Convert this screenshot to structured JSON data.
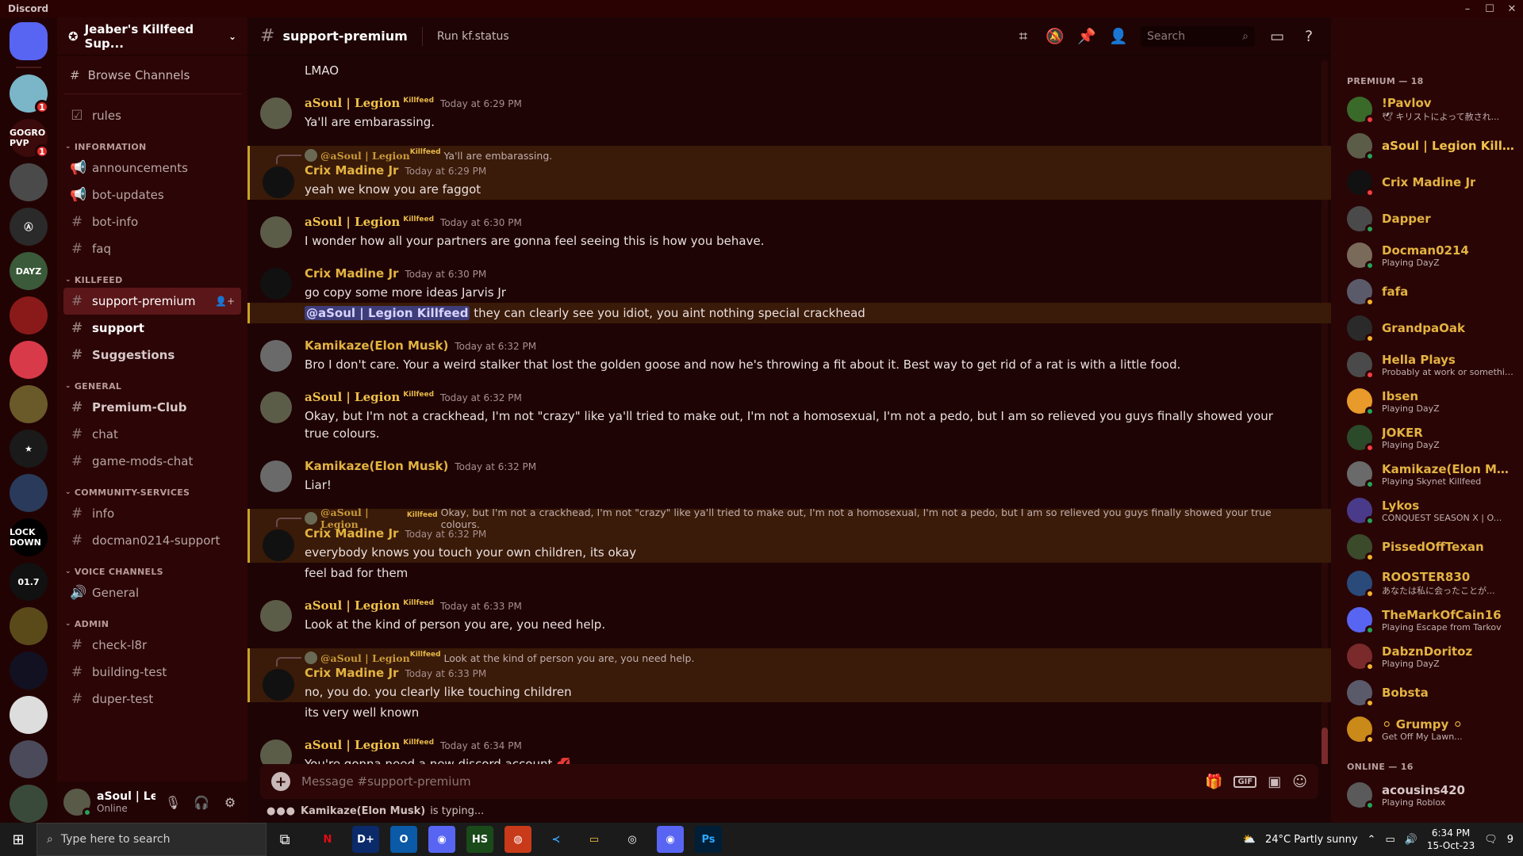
{
  "window": {
    "title": "Discord",
    "controls": [
      "–",
      "☐",
      "✕"
    ]
  },
  "rail": {
    "servers": [
      {
        "label": "",
        "color": "#5865f2",
        "badge": ""
      },
      {
        "label": "",
        "color": "#7ab6c8",
        "badge": "1"
      },
      {
        "label": "GOGRO PVP",
        "color": "#3b0a0a",
        "badge": "1"
      },
      {
        "label": "",
        "color": "#4a4a4a",
        "badge": ""
      },
      {
        "label": "Ⓐ",
        "color": "#2a2a2a",
        "badge": ""
      },
      {
        "label": "DAYZ",
        "color": "#3a5a3a",
        "badge": ""
      },
      {
        "label": "",
        "color": "#8a1a1a",
        "badge": ""
      },
      {
        "label": "",
        "color": "#d83a4a",
        "badge": ""
      },
      {
        "label": "",
        "color": "#6a5a2a",
        "badge": ""
      },
      {
        "label": "★",
        "color": "#1a1a1a",
        "badge": ""
      },
      {
        "label": "",
        "color": "#2a3a5a",
        "badge": ""
      },
      {
        "label": "LOCK DOWN",
        "color": "#000000",
        "badge": ""
      },
      {
        "label": "01.7",
        "color": "#111111",
        "badge": ""
      },
      {
        "label": "",
        "color": "#5a4a1a",
        "badge": ""
      },
      {
        "label": "",
        "color": "#111122",
        "badge": ""
      },
      {
        "label": "",
        "color": "#dddddd",
        "badge": ""
      },
      {
        "label": "",
        "color": "#4a4a5a",
        "badge": ""
      },
      {
        "label": "",
        "color": "#3a4a3a",
        "badge": ""
      }
    ]
  },
  "sidebar": {
    "server_name": "Jeaber's Killfeed Sup...",
    "browse_label": "Browse Channels",
    "rules_channel": "rules",
    "categories": [
      {
        "name": "INFORMATION",
        "channels": [
          {
            "name": "announcements",
            "icon": "📢",
            "state": ""
          },
          {
            "name": "bot-updates",
            "icon": "📢",
            "state": ""
          },
          {
            "name": "bot-info",
            "icon": "#",
            "state": ""
          },
          {
            "name": "faq",
            "icon": "#",
            "state": ""
          }
        ]
      },
      {
        "name": "KILLFEED",
        "channels": [
          {
            "name": "support-premium",
            "icon": "#",
            "state": "active"
          },
          {
            "name": "support",
            "icon": "#",
            "state": "unread"
          },
          {
            "name": "Suggestions",
            "icon": "#",
            "state": "bold"
          }
        ]
      },
      {
        "name": "GENERAL",
        "channels": [
          {
            "name": "Premium-Club",
            "icon": "#",
            "state": "bold"
          },
          {
            "name": "chat",
            "icon": "#",
            "state": ""
          },
          {
            "name": "game-mods-chat",
            "icon": "#",
            "state": ""
          }
        ]
      },
      {
        "name": "COMMUNITY-SERVICES",
        "channels": [
          {
            "name": "info",
            "icon": "#",
            "state": ""
          },
          {
            "name": "docman0214-support",
            "icon": "#",
            "state": ""
          }
        ]
      },
      {
        "name": "VOICE CHANNELS",
        "channels": [
          {
            "name": "General",
            "icon": "🔊",
            "state": ""
          }
        ]
      },
      {
        "name": "ADMIN",
        "channels": [
          {
            "name": "check-l8r",
            "icon": "#",
            "state": ""
          },
          {
            "name": "building-test",
            "icon": "#",
            "state": ""
          },
          {
            "name": "duper-test",
            "icon": "#",
            "state": ""
          }
        ]
      }
    ],
    "user": {
      "name": "aSoul | Le...",
      "status": "Online"
    }
  },
  "header": {
    "channel": "support-premium",
    "topic": "Run kf.status",
    "search_placeholder": "Search"
  },
  "messages": [
    {
      "group": false,
      "author": "",
      "tag": "",
      "time": "",
      "text": "LMAO",
      "avatar": "",
      "color": "",
      "reply": null,
      "highlight": false,
      "mention": ""
    },
    {
      "group": true,
      "author": "aSoul | Legion",
      "tag": "Killfeed",
      "time": "Today at 6:29 PM",
      "text": "Ya'll are embarassing.",
      "avatar": "#5c5d48",
      "color": "c-legion",
      "reply": null,
      "highlight": false,
      "mention": ""
    },
    {
      "group": true,
      "author": "Crix Madine Jr",
      "tag": "",
      "time": "Today at 6:29 PM",
      "text": "yeah we know you are faggot",
      "avatar": "#111111",
      "color": "c-gold",
      "reply": {
        "name": "@aSoul | Legion",
        "tag": "Killfeed",
        "text": "Ya'll are embarassing."
      },
      "highlight": true,
      "mention": ""
    },
    {
      "group": true,
      "author": "aSoul | Legion",
      "tag": "Killfeed",
      "time": "Today at 6:30 PM",
      "text": "I wonder how all your partners are gonna feel seeing this is how you behave.",
      "avatar": "#5c5d48",
      "color": "c-legion",
      "reply": null,
      "highlight": false,
      "mention": ""
    },
    {
      "group": true,
      "author": "Crix Madine Jr",
      "tag": "",
      "time": "Today at 6:30 PM",
      "text": "go copy some more ideas Jarvis Jr",
      "avatar": "#111111",
      "color": "c-gold",
      "reply": null,
      "highlight": false,
      "mention": ""
    },
    {
      "group": false,
      "author": "",
      "tag": "",
      "time": "",
      "text": "they can clearly see you idiot, you aint nothing special crackhead",
      "avatar": "",
      "color": "",
      "reply": null,
      "highlight": true,
      "mention": "@aSoul | Legion Killfeed"
    },
    {
      "group": true,
      "author": "Kamikaze(Elon Musk)",
      "tag": "",
      "time": "Today at 6:32 PM",
      "text": "Bro I don't care. Your a weird stalker that lost the golden goose and now he's throwing a fit about it. Best way to get rid of a rat is with a little food.",
      "avatar": "#6a6a6a",
      "color": "c-gold",
      "reply": null,
      "highlight": false,
      "mention": ""
    },
    {
      "group": true,
      "author": "aSoul | Legion",
      "tag": "Killfeed",
      "time": "Today at 6:32 PM",
      "text": "Okay, but I'm not a crackhead, I'm not \"crazy\" like ya'll tried to make out, I'm not a homosexual, I'm not a pedo, but I am so relieved you guys finally showed your true colours.",
      "avatar": "#5c5d48",
      "color": "c-legion",
      "reply": null,
      "highlight": false,
      "mention": ""
    },
    {
      "group": true,
      "author": "Kamikaze(Elon Musk)",
      "tag": "",
      "time": "Today at 6:32 PM",
      "text": "Liar!",
      "avatar": "#6a6a6a",
      "color": "c-gold",
      "reply": null,
      "highlight": false,
      "mention": ""
    },
    {
      "group": true,
      "author": "Crix Madine Jr",
      "tag": "",
      "time": "Today at 6:32 PM",
      "text": "everybody knows you touch your own children, its okay",
      "avatar": "#111111",
      "color": "c-gold",
      "reply": {
        "name": "@aSoul | Legion",
        "tag": "Killfeed",
        "text": "Okay, but I'm not a crackhead, I'm not \"crazy\" like ya'll tried to make out, I'm not a homosexual, I'm not a pedo, but I am so relieved you guys finally showed your true colours."
      },
      "highlight": true,
      "mention": ""
    },
    {
      "group": false,
      "author": "",
      "tag": "",
      "time": "",
      "text": "feel bad for them",
      "avatar": "",
      "color": "",
      "reply": null,
      "highlight": false,
      "mention": ""
    },
    {
      "group": true,
      "author": "aSoul | Legion",
      "tag": "Killfeed",
      "time": "Today at 6:33 PM",
      "text": "Look at the kind of person you are, you need help.",
      "avatar": "#5c5d48",
      "color": "c-legion",
      "reply": null,
      "highlight": false,
      "mention": ""
    },
    {
      "group": true,
      "author": "Crix Madine Jr",
      "tag": "",
      "time": "Today at 6:33 PM",
      "text": "no, you do. you clearly like touching children",
      "avatar": "#111111",
      "color": "c-gold",
      "reply": {
        "name": "@aSoul | Legion",
        "tag": "Killfeed",
        "text": "Look at the kind of person you are, you need help."
      },
      "highlight": true,
      "mention": ""
    },
    {
      "group": false,
      "author": "",
      "tag": "",
      "time": "",
      "text": "its very well known",
      "avatar": "",
      "color": "",
      "reply": null,
      "highlight": false,
      "mention": ""
    },
    {
      "group": true,
      "author": "aSoul | Legion",
      "tag": "Killfeed",
      "time": "Today at 6:34 PM",
      "text": "You're gonna need a new discord account 💋",
      "avatar": "#5c5d48",
      "color": "c-legion",
      "reply": null,
      "highlight": false,
      "mention": ""
    }
  ],
  "composer": {
    "placeholder": "Message #support-premium",
    "gif_label": "GIF"
  },
  "typing": {
    "user": "Kamikaze(Elon Musk)",
    "suffix": "is typing..."
  },
  "members": {
    "premium_header": "PREMIUM — 18",
    "online_header": "ONLINE — 16",
    "premium": [
      {
        "name": "!Pavlov",
        "activity": "🕊 キリストによって赦され...",
        "color": "#e3b341",
        "avatar": "#3a6a2a",
        "status": "dnd"
      },
      {
        "name": "aSoul | Legion Killfeed",
        "activity": "",
        "color": "#f0c24a",
        "avatar": "#5c5d48",
        "status": "on"
      },
      {
        "name": "Crix Madine Jr",
        "activity": "",
        "color": "#e3b341",
        "avatar": "#111111",
        "status": "dnd"
      },
      {
        "name": "Dapper",
        "activity": "",
        "color": "#e3b341",
        "avatar": "#4a4a4a",
        "status": "on"
      },
      {
        "name": "Docman0214",
        "activity": "Playing DayZ",
        "color": "#e3b341",
        "avatar": "#7a6a5a",
        "status": "on"
      },
      {
        "name": "fafa",
        "activity": "",
        "color": "#e3b341",
        "avatar": "#5a5a6a",
        "status": "idle"
      },
      {
        "name": "GrandpaOak",
        "activity": "",
        "color": "#e3b341",
        "avatar": "#2a2a2a",
        "status": "idle"
      },
      {
        "name": "Hella Plays",
        "activity": "Probably at work or something!",
        "color": "#e3b341",
        "avatar": "#4a4a4a",
        "status": "dnd"
      },
      {
        "name": "Ibsen",
        "activity": "Playing DayZ",
        "color": "#e3b341",
        "avatar": "#e89a2a",
        "status": "on"
      },
      {
        "name": "JOKER",
        "activity": "Playing DayZ",
        "color": "#e3b341",
        "avatar": "#2a4a2a",
        "status": "dnd"
      },
      {
        "name": "Kamikaze(Elon Musk)",
        "activity": "Playing Skynet Killfeed",
        "color": "#e3b341",
        "avatar": "#6a6a6a",
        "status": "on"
      },
      {
        "name": "Lykos",
        "activity": "CONQUEST SEASON X | O...",
        "color": "#e3b341",
        "avatar": "#4a3a8a",
        "status": "on"
      },
      {
        "name": "PissedOffTexan",
        "activity": "",
        "color": "#e3b341",
        "avatar": "#3a4a2a",
        "status": "idle"
      },
      {
        "name": "ROOSTER830",
        "activity": "あなたは私に会ったことが...",
        "color": "#e3b341",
        "avatar": "#2a4a7a",
        "status": "idle"
      },
      {
        "name": "TheMarkOfCain16",
        "activity": "Playing Escape from Tarkov",
        "color": "#e3b341",
        "avatar": "#5865f2",
        "status": "on"
      },
      {
        "name": "DabznDoritoz",
        "activity": "Playing DayZ",
        "color": "#e3b341",
        "avatar": "#7a2a2a",
        "status": "idle"
      },
      {
        "name": "Bobsta",
        "activity": "",
        "color": "#e3b341",
        "avatar": "#5a5a6a",
        "status": "idle"
      },
      {
        "name": "⚪ Grumpy ⚪",
        "activity": "Get Off My Lawn...",
        "color": "#e3b341",
        "avatar": "#c98a1a",
        "status": "idle"
      }
    ],
    "online": [
      {
        "name": "acousins420",
        "activity": "Playing Roblox",
        "color": "#d8c8c8",
        "avatar": "#5a5a5a",
        "status": "on"
      }
    ]
  },
  "taskbar": {
    "search_placeholder": "Type here to search",
    "weather": "24°C  Partly sunny",
    "time": "6:34 PM",
    "date": "15-Oct-23",
    "notifications": "9",
    "apps": [
      {
        "label": "N",
        "color": "#e50914",
        "bg": "#1b1b1b"
      },
      {
        "label": "D+",
        "color": "#ffffff",
        "bg": "#0a2a6a"
      },
      {
        "label": "O",
        "color": "#ffffff",
        "bg": "#0a5aa8"
      },
      {
        "label": "◉",
        "color": "#ffffff",
        "bg": "#5865f2"
      },
      {
        "label": "HS",
        "color": "#ffffff",
        "bg": "#1a4a1a"
      },
      {
        "label": "◍",
        "color": "#ffffff",
        "bg": "#c83a1a"
      },
      {
        "label": "≺",
        "color": "#3aa0f0",
        "bg": "#1b1b1b"
      },
      {
        "label": "▭",
        "color": "#f0c040",
        "bg": "#1b1b1b"
      },
      {
        "label": "◎",
        "color": "#ffffff",
        "bg": "#1b1b1b"
      },
      {
        "label": "◉",
        "color": "#ffffff",
        "bg": "#5865f2"
      },
      {
        "label": "Ps",
        "color": "#31a8ff",
        "bg": "#001e36"
      }
    ]
  }
}
